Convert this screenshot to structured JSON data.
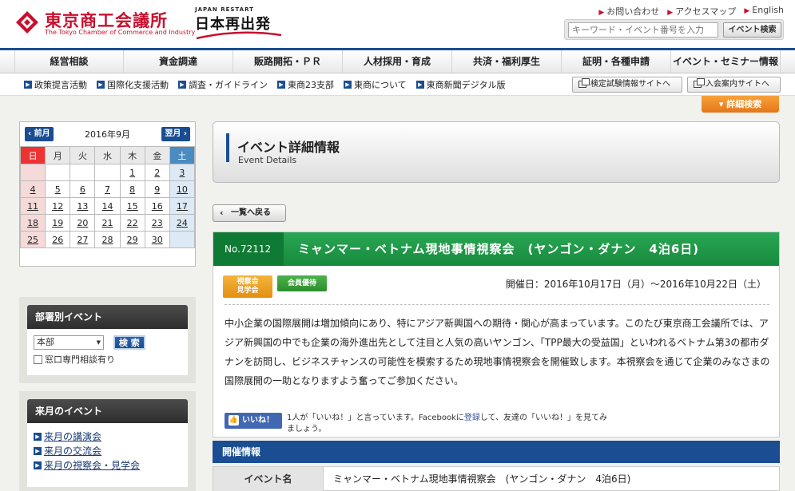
{
  "header": {
    "logo_jp": "東京商工会議所",
    "logo_en": "The Tokyo Chamber of Commerce and Industry",
    "restart_en": "JAPAN RESTART",
    "restart_jp": "日本再出発",
    "utility": [
      "お問い合わせ",
      "アクセスマップ",
      "English"
    ],
    "search_placeholder": "キーワード・イベント番号を入力",
    "search_button": "イベント検索"
  },
  "main_nav": [
    "経営相談",
    "資金調達",
    "販路開拓・ＰＲ",
    "人材採用・育成",
    "共済・福利厚生",
    "証明・各種申請",
    "イベント・セミナー情報"
  ],
  "sub_nav": [
    "政策提言活動",
    "国際化支援活動",
    "調査・ガイドライン",
    "東商23支部",
    "東商について",
    "東商新聞デジタル版"
  ],
  "ext_links": [
    "検定試験情報サイトへ",
    "入会案内サイトへ"
  ],
  "detail_search": "詳細検索",
  "calendar": {
    "prev": "前月",
    "next": "翌月",
    "title": "2016年9月",
    "weekdays": [
      "日",
      "月",
      "火",
      "水",
      "木",
      "金",
      "土"
    ],
    "weeks": [
      [
        "",
        "",
        "",
        "",
        "1",
        "2",
        "3"
      ],
      [
        "4",
        "5",
        "6",
        "7",
        "8",
        "9",
        "10"
      ],
      [
        "11",
        "12",
        "13",
        "14",
        "15",
        "16",
        "17"
      ],
      [
        "18",
        "19",
        "20",
        "21",
        "22",
        "23",
        "24"
      ],
      [
        "25",
        "26",
        "27",
        "28",
        "29",
        "30",
        ""
      ]
    ]
  },
  "dept_box": {
    "title": "部署別イベント",
    "select_value": "本部",
    "search_button": "検 索",
    "checkbox_label": "窓口専門相談有り"
  },
  "next_month_box": {
    "title": "来月のイベント",
    "links": [
      "来月の講演会",
      "来月の交流会",
      "来月の視察会・見学会"
    ]
  },
  "page_title": {
    "jp": "イベント詳細情報",
    "en": "Event Details"
  },
  "back_button": "一覧へ戻る",
  "event": {
    "number": "No.72112",
    "title": "ミャンマー・ベトナム現地事情視察会　(ヤンゴン・ダナン　4泊6日)",
    "badge1_line1": "視察会",
    "badge1_line2": "見学会",
    "badge2": "会員優待",
    "date": "開催日：2016年10月17日（月）～2016年10月22日（土）",
    "description": "中小企業の国際展開は増加傾向にあり、特にアジア新興国への期待・関心が高まっています。このたび東京商工会議所では、アジア新興国の中でも企業の海外進出先として注目と人気の高いヤンゴン、「TPP最大の受益国」といわれるベトナム第3の都市ダナンを訪問し、ビジネスチャンスの可能性を模索するため現地事情視察会を開催致します。本視察会を通じて企業のみなさまの国際展開の一助となりますよう奮ってご参加ください。",
    "fb_button": "いいね！",
    "fb_text_pre": "1人が「いいね！」と言っています。Facebookに",
    "fb_text_link": "登録",
    "fb_text_post": "して、友達の「いいね！」を見てみましょう。"
  },
  "info": {
    "header": "開催情報",
    "rows": [
      {
        "label": "イベント名",
        "value": "ミャンマー・ベトナム現地事情視察会　(ヤンゴン・ダナン　4泊6日)"
      }
    ]
  },
  "colors": {
    "brand_red": "#c8102e",
    "nav_blue": "#1a4d92",
    "event_green": "#1f9a48",
    "accent_orange": "#e8801f"
  }
}
